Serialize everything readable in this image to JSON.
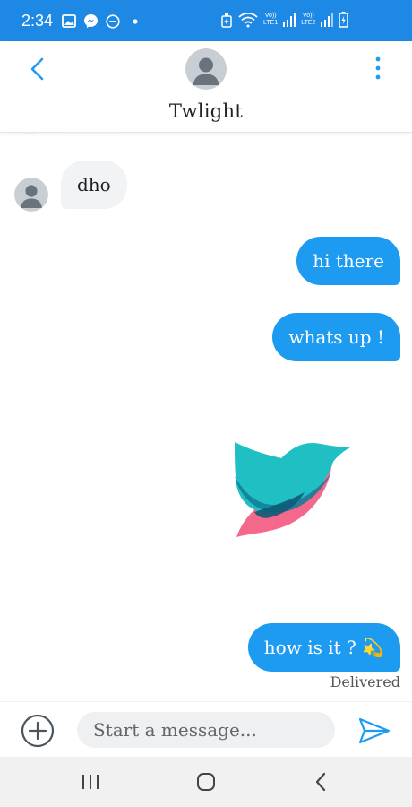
{
  "status_bar": {
    "time": "2:34",
    "lte1": "LTE1",
    "lte2": "LTE2",
    "volte": "Vo))",
    "left_icons": [
      "image-icon",
      "messenger-icon",
      "do-not-disturb-icon",
      "dot-icon"
    ],
    "right_icons": [
      "alarm-icon",
      "wifi-icon",
      "signal-icon",
      "battery-charging-icon"
    ]
  },
  "header": {
    "title": "Twlight",
    "back_icon": "chevron-left-icon",
    "menu_icon": "more-vertical-icon"
  },
  "messages": [
    {
      "direction": "received",
      "text": "dho"
    },
    {
      "direction": "sent",
      "text": "hi there"
    },
    {
      "direction": "sent",
      "text": "whats up !"
    },
    {
      "direction": "sent",
      "type": "sticker",
      "sticker": "bird-logo-sticker"
    },
    {
      "direction": "sent",
      "text": "how is it ? 💫"
    }
  ],
  "delivery_status": "Delivered",
  "composer": {
    "placeholder": "Start a message...",
    "add_icon": "plus-circle-icon",
    "send_icon": "send-icon"
  },
  "nav_bar": {
    "icons": [
      "recent-apps-icon",
      "home-icon",
      "back-icon"
    ]
  },
  "colors": {
    "status_bar": "#1e88e5",
    "accent": "#1d9bf0",
    "received_bubble": "#f1f3f4",
    "sticker_teal": "#1fbfc4",
    "sticker_pink": "#f4688c"
  }
}
